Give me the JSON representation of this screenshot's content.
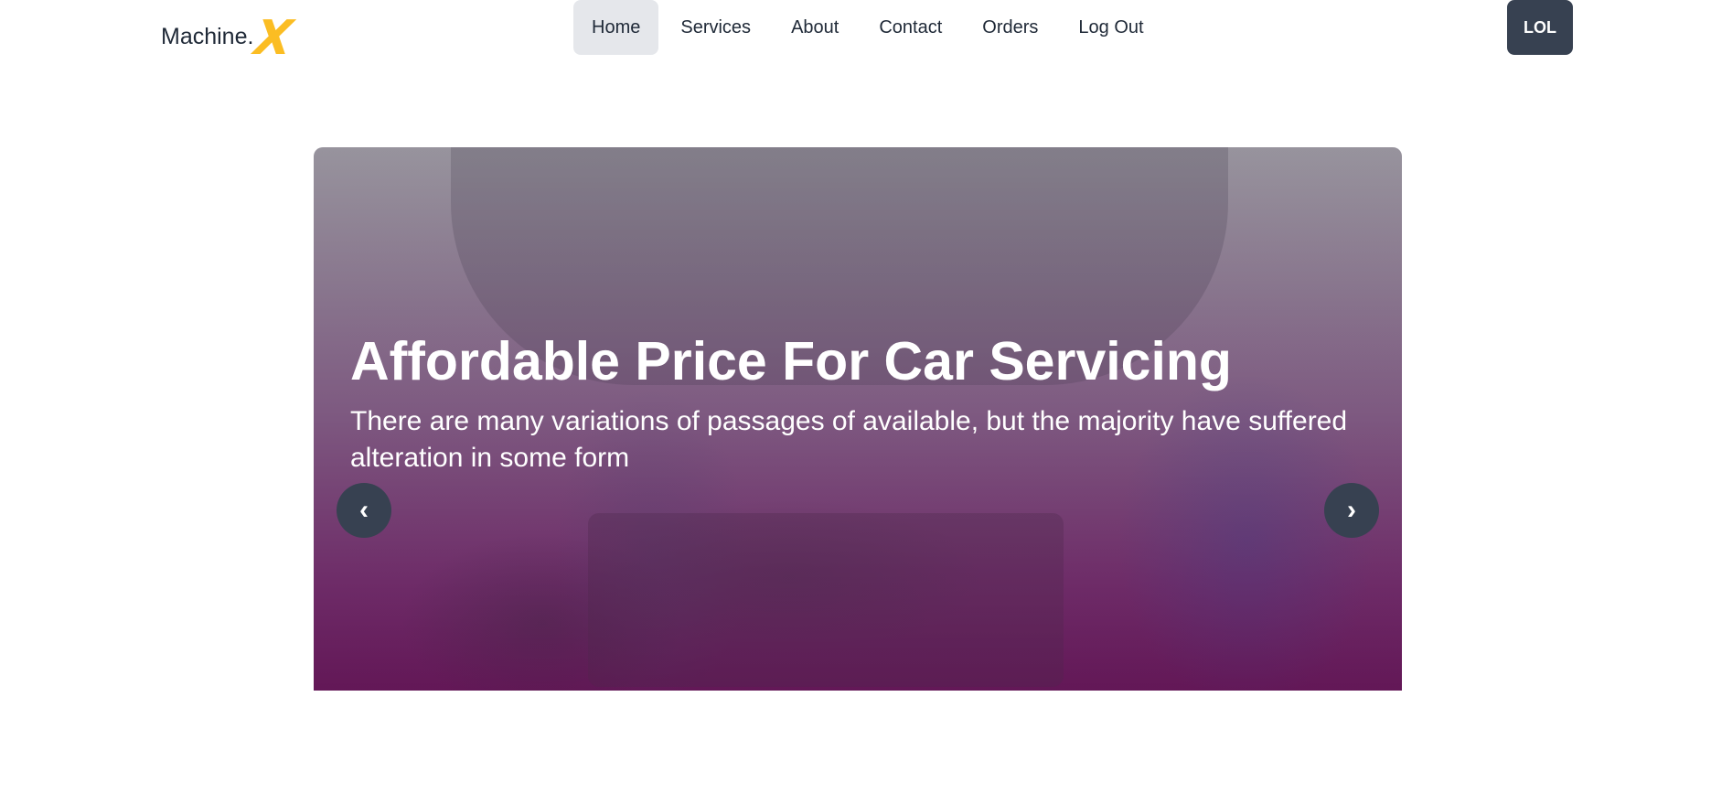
{
  "brand": {
    "text": "Machine.",
    "mark": "X",
    "mark_color": "#fbbd23"
  },
  "nav": {
    "items": [
      {
        "label": "Home",
        "active": true
      },
      {
        "label": "Services",
        "active": false
      },
      {
        "label": "About",
        "active": false
      },
      {
        "label": "Contact",
        "active": false
      },
      {
        "label": "Orders",
        "active": false
      },
      {
        "label": "Log Out",
        "active": false
      }
    ]
  },
  "user": {
    "label": "LOL"
  },
  "hero": {
    "title": "Affordable Price For Car Servicing",
    "subtitle": "There are many variations of passages of available, but the majority have suffered alteration in some form",
    "prev_icon": "chevron-left-icon",
    "prev_glyph": "‹",
    "next_icon": "chevron-right-icon",
    "next_glyph": "›"
  },
  "colors": {
    "button_dark": "#374151",
    "active_nav_bg": "#e5e7eb",
    "accent": "#fbbd23"
  }
}
